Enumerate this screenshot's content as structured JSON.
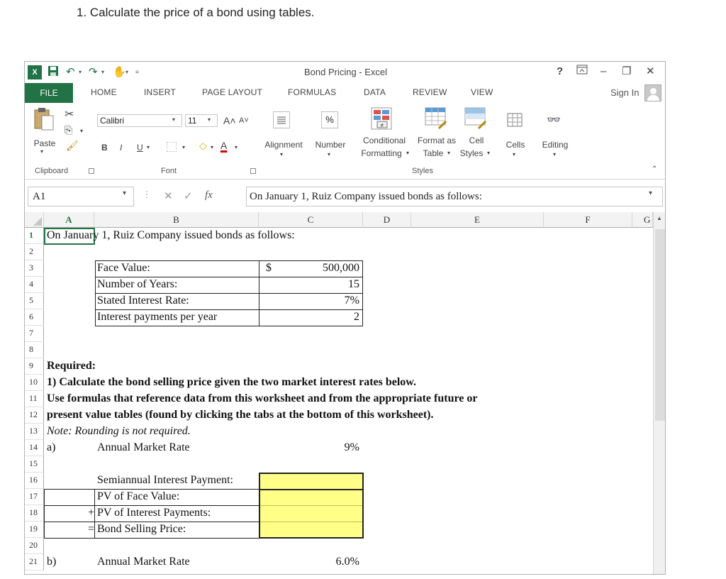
{
  "question": "1. Calculate the price of a bond using tables.",
  "window": {
    "title": "Bond Pricing - Excel",
    "help": "?",
    "sign_in": "Sign In"
  },
  "tabs": [
    "FILE",
    "HOME",
    "INSERT",
    "PAGE LAYOUT",
    "FORMULAS",
    "DATA",
    "REVIEW",
    "VIEW"
  ],
  "ribbon": {
    "paste": "Paste",
    "clipboard": "Clipboard",
    "font_name": "Calibri",
    "font_size": "11",
    "font_group": "Font",
    "bold": "B",
    "italic": "I",
    "underline": "U",
    "alignment": "Alignment",
    "number": "Number",
    "percent": "%",
    "conditional1": "Conditional",
    "conditional2": "Formatting",
    "format_as1": "Format as",
    "format_as2": "Table",
    "cell_styles1": "Cell",
    "cell_styles2": "Styles",
    "styles_group": "Styles",
    "cells": "Cells",
    "editing": "Editing"
  },
  "formula_bar": {
    "name_box": "A1",
    "fx": "fx",
    "content": "On January 1, Ruiz Company issued bonds as follows:"
  },
  "columns": [
    "A",
    "B",
    "C",
    "D",
    "E",
    "F",
    "G"
  ],
  "rows": [
    "1",
    "2",
    "3",
    "4",
    "5",
    "6",
    "7",
    "8",
    "9",
    "10",
    "11",
    "12",
    "13",
    "14",
    "15",
    "16",
    "17",
    "18",
    "19",
    "20",
    "21"
  ],
  "sheet": {
    "a1": "On January 1, Ruiz Company issued bonds as follows:",
    "face_value_label": "Face Value:",
    "face_value_currency": "$",
    "face_value": "500,000",
    "years_label": "Number of Years:",
    "years": "15",
    "rate_label": "Stated Interest Rate:",
    "rate": "7%",
    "payments_label": "Interest payments per year",
    "payments": "2",
    "required": "Required:",
    "req1": "1) Calculate the bond selling price given the two market interest rates below.",
    "req2": "Use formulas that reference data from this worksheet and from the appropriate future or",
    "req3": "present value tables (found by clicking the tabs at the bottom of this worksheet).",
    "note": "Note: Rounding is not required.",
    "a_label": "a)",
    "annual_rate_label": "Annual Market Rate",
    "a_rate": "9%",
    "semi_payment": "Semiannual Interest Payment:",
    "pv_face": "PV of Face Value:",
    "plus": "+",
    "pv_interest": "PV of Interest Payments:",
    "equals": "=",
    "bond_price": "Bond Selling Price:",
    "b_label": "b)",
    "b_rate_label": "Annual Market Rate",
    "b_rate": "6.0%"
  }
}
